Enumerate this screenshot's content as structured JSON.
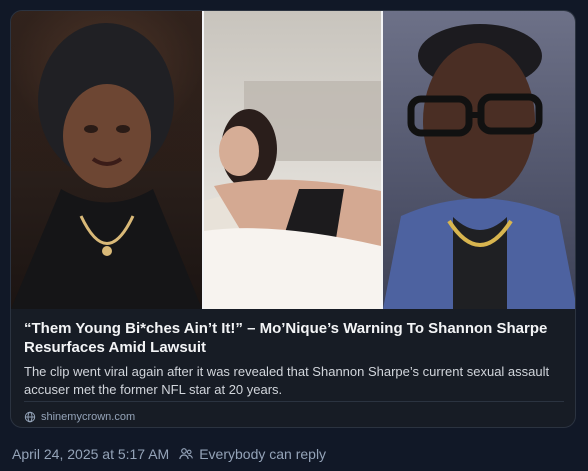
{
  "post": {
    "card": {
      "title": "“Them Young Bi*ches Ain’t It!” – Mo’Nique’s Warning To Shannon Sharpe Resurfaces Amid Lawsuit",
      "description": "The clip went viral again after it was revealed that Shannon Sharpe’s current sexual assault accuser met the former NFL star at 20 years.",
      "source": "shinemycrown.com",
      "source_icon": "globe-icon"
    },
    "timestamp": "April 24, 2025 at 5:17 AM",
    "reply_setting": "Everybody can reply",
    "reply_icon": "people-icon",
    "images": [
      "woman-portrait",
      "woman-on-bed",
      "man-with-glasses"
    ]
  },
  "colors": {
    "background": "#111827",
    "card_background": "#171c25",
    "text_primary": "#f3f4f6",
    "text_secondary": "#94a3b8"
  }
}
